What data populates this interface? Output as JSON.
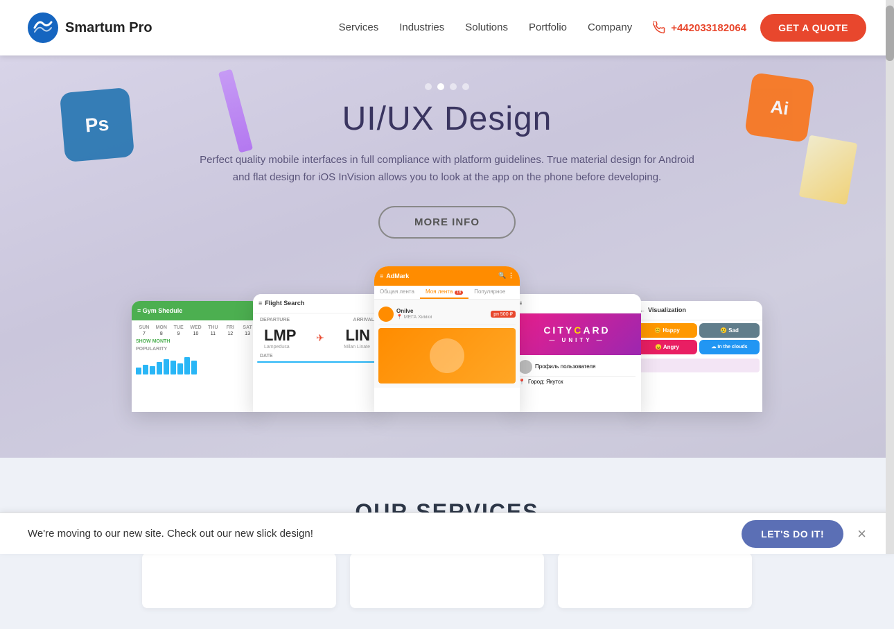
{
  "navbar": {
    "logo_text": "Smartum Pro",
    "nav_links": [
      {
        "id": "services",
        "label": "Services"
      },
      {
        "id": "industries",
        "label": "Industries"
      },
      {
        "id": "solutions",
        "label": "Solutions"
      },
      {
        "id": "portfolio",
        "label": "Portfolio"
      },
      {
        "id": "company",
        "label": "Company"
      }
    ],
    "phone": "+442033182064",
    "quote_button": "GET A QUOTE"
  },
  "hero": {
    "dots": [
      {
        "active": false
      },
      {
        "active": true
      },
      {
        "active": false
      },
      {
        "active": false
      }
    ],
    "title": "UI/UX Design",
    "description": "Perfect quality mobile interfaces in full compliance with platform guidelines. True material design for Android and flat design for iOS InVision allows you to look at the app on the phone before developing.",
    "more_info_button": "MORE INFO",
    "bg_ps_label": "Ps",
    "bg_ai_label": "Ai",
    "phones": {
      "gym": {
        "header": "Gym Shedule",
        "days": [
          "SUN",
          "MON",
          "TUE",
          "WED",
          "THU",
          "FRI",
          "SAT"
        ],
        "show_month": "SHOW MONTH"
      },
      "flight": {
        "header": "Flight Search",
        "departure_label": "DEPARTURE",
        "arrival_label": "ARRIVAL",
        "from_code": "LMP",
        "from_name": "Lampedusa",
        "to_code": "LIN",
        "to_name": "Milan Linate",
        "date_label": "DATE"
      },
      "admark": {
        "header": "AdMark",
        "tabs": [
          "Общая лента",
          "Моя лента",
          "Популярное"
        ],
        "active_tab": 1
      },
      "citycard": {
        "title": "CITYCARD",
        "subtitle": "UNITY",
        "profile_label": "Профиль пользователя",
        "city_label": "Город: Якутск"
      },
      "viz": {
        "header": "Visualization",
        "moods": [
          {
            "label": "Happy",
            "color": "#ff9800"
          },
          {
            "label": "Sad",
            "color": "#607d8b"
          },
          {
            "label": "Angry",
            "color": "#e91e63"
          },
          {
            "label": "In the clouds",
            "color": "#2196f3"
          }
        ]
      }
    }
  },
  "services_section": {
    "title": "OUR SERVICES",
    "cards": [
      {
        "id": "card-1"
      },
      {
        "id": "card-2"
      },
      {
        "id": "card-3"
      }
    ]
  },
  "notification": {
    "text": "We're moving to our new site. Check out our new slick design!",
    "button_label": "LET'S DO IT!",
    "close_label": "×"
  }
}
